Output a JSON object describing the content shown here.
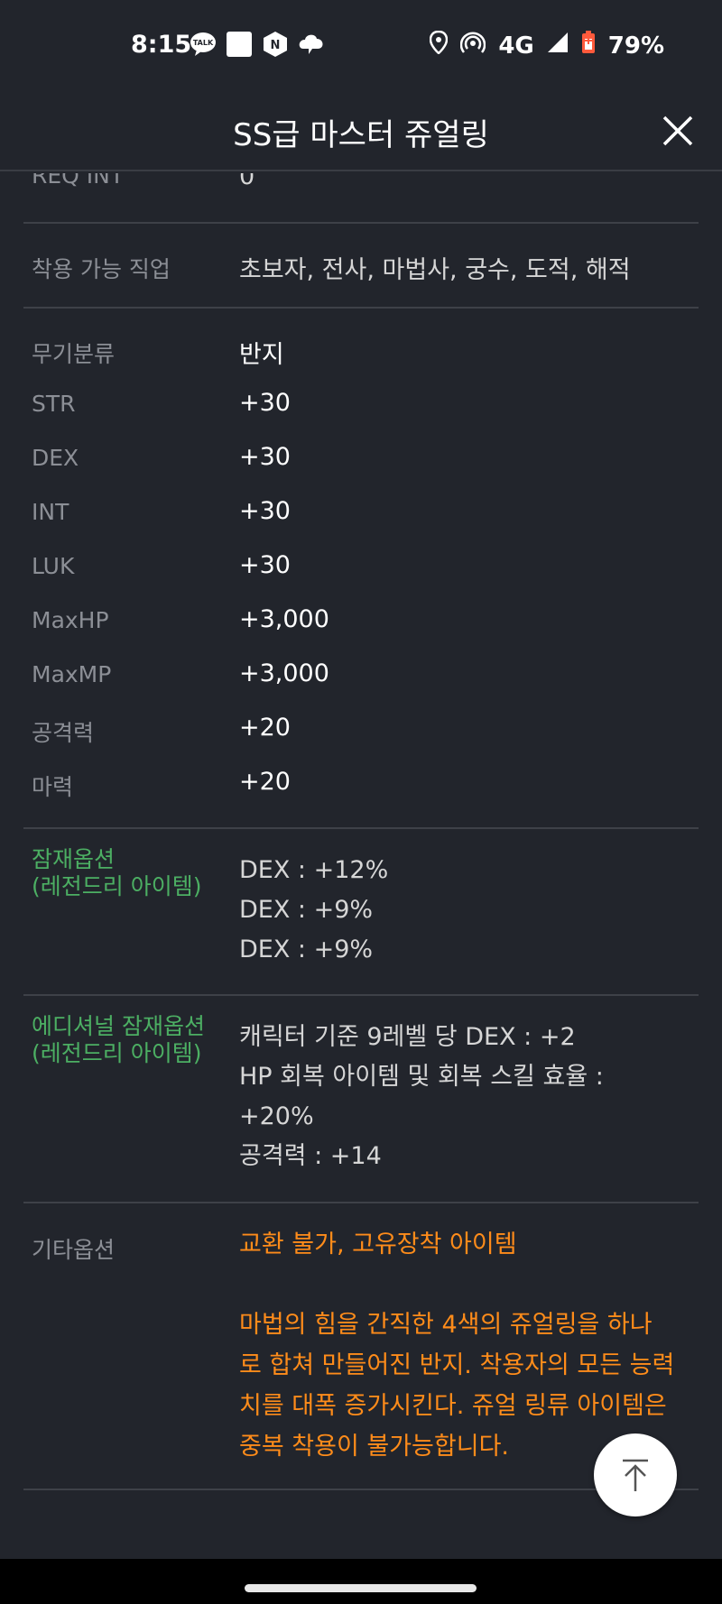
{
  "status_bar": {
    "time": "8:15",
    "network": "4G",
    "battery": "79%",
    "notification_icons": [
      "talk-icon",
      "square-icon",
      "naver-icon",
      "cloud-app-icon"
    ],
    "system_icons": [
      "location-icon",
      "hotspot-icon",
      "signal-icon",
      "battery-icon"
    ]
  },
  "header": {
    "title": "SS급 마스터 쥬얼링"
  },
  "rows": {
    "req_int": {
      "label": "REQ INT",
      "value": "0"
    },
    "jobs": {
      "label": "착용 가능 직업",
      "value": "초보자, 전사, 마법사, 궁수, 도적, 해적"
    },
    "stats": [
      {
        "label": "무기분류",
        "value": "반지"
      },
      {
        "label": "STR",
        "value": "+30"
      },
      {
        "label": "DEX",
        "value": "+30"
      },
      {
        "label": "INT",
        "value": "+30"
      },
      {
        "label": "LUK",
        "value": "+30"
      },
      {
        "label": "MaxHP",
        "value": "+3,000"
      },
      {
        "label": "MaxMP",
        "value": "+3,000"
      },
      {
        "label": "공격력",
        "value": "+20"
      },
      {
        "label": "마력",
        "value": "+20"
      }
    ],
    "potential": {
      "label_line1": "잠재옵션",
      "label_line2": "(레전드리 아이템)",
      "values": [
        "DEX : +12%",
        "DEX : +9%",
        "DEX : +9%"
      ]
    },
    "additional_potential": {
      "label_line1": "에디셔널 잠재옵션",
      "label_line2": "(레전드리 아이템)",
      "values": [
        "캐릭터 기준 9레벨 당 DEX : +2",
        "HP 회복 아이템 및 회복 스킬 효율 :",
        "+20%",
        "공격력 : +14"
      ]
    },
    "other": {
      "label": "기타옵션",
      "value": "교환 불가, 고유장착 아이템",
      "description_lines": [
        "마법의 힘을 간직한 4색의 쥬얼링을 하나",
        "로 합쳐 만들어진 반지. 착용자의 모든 능력",
        "치를 대폭 증가시킨다. 쥬얼 링류 아이템은",
        "중복 착용이 불가능합니다."
      ]
    }
  },
  "colors": {
    "background": "#22252c",
    "label": "#8c8f96",
    "potential_label": "#4caf63",
    "other_value": "#ff8c1a"
  }
}
